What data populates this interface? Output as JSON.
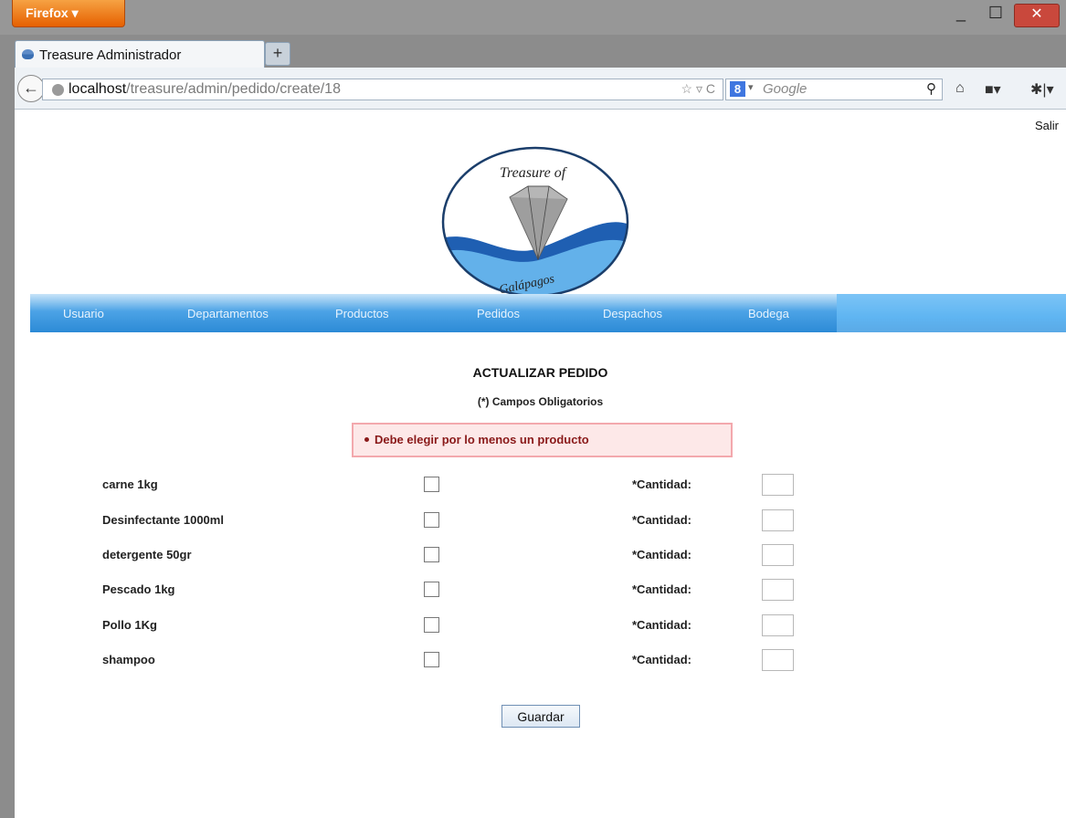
{
  "browser": {
    "app_button": "Firefox",
    "tab_title": "Treasure Administrador",
    "new_tab": "+",
    "url_host": "localhost",
    "url_path": "/treasure/admin/pedido/create/18",
    "search_placeholder": "Google",
    "search_engine_glyph": "8"
  },
  "page": {
    "logout": "Salir",
    "logo_text_top": "Treasure of",
    "logo_text_bottom": "Galápagos",
    "menu": [
      "Usuario",
      "Departamentos",
      "Productos",
      "Pedidos",
      "Despachos",
      "Bodega"
    ],
    "form_title": "ACTUALIZAR PEDIDO",
    "form_subtitle": "(*) Campos Obligatorios",
    "error_message": "Debe elegir por lo menos un producto",
    "quantity_label": "*Cantidad:",
    "products": [
      "carne 1kg",
      "Desinfectante 1000ml",
      "detergente 50gr",
      "Pescado 1kg",
      "Pollo 1Kg",
      "shampoo"
    ],
    "save_button": "Guardar"
  },
  "colors": {
    "menu_gradient_bottom": "#2c8ad6",
    "error_bg": "#fde8e8",
    "error_border": "#f3a8ad",
    "error_text": "#8a1a1a",
    "firefox_orange": "#e66000"
  }
}
